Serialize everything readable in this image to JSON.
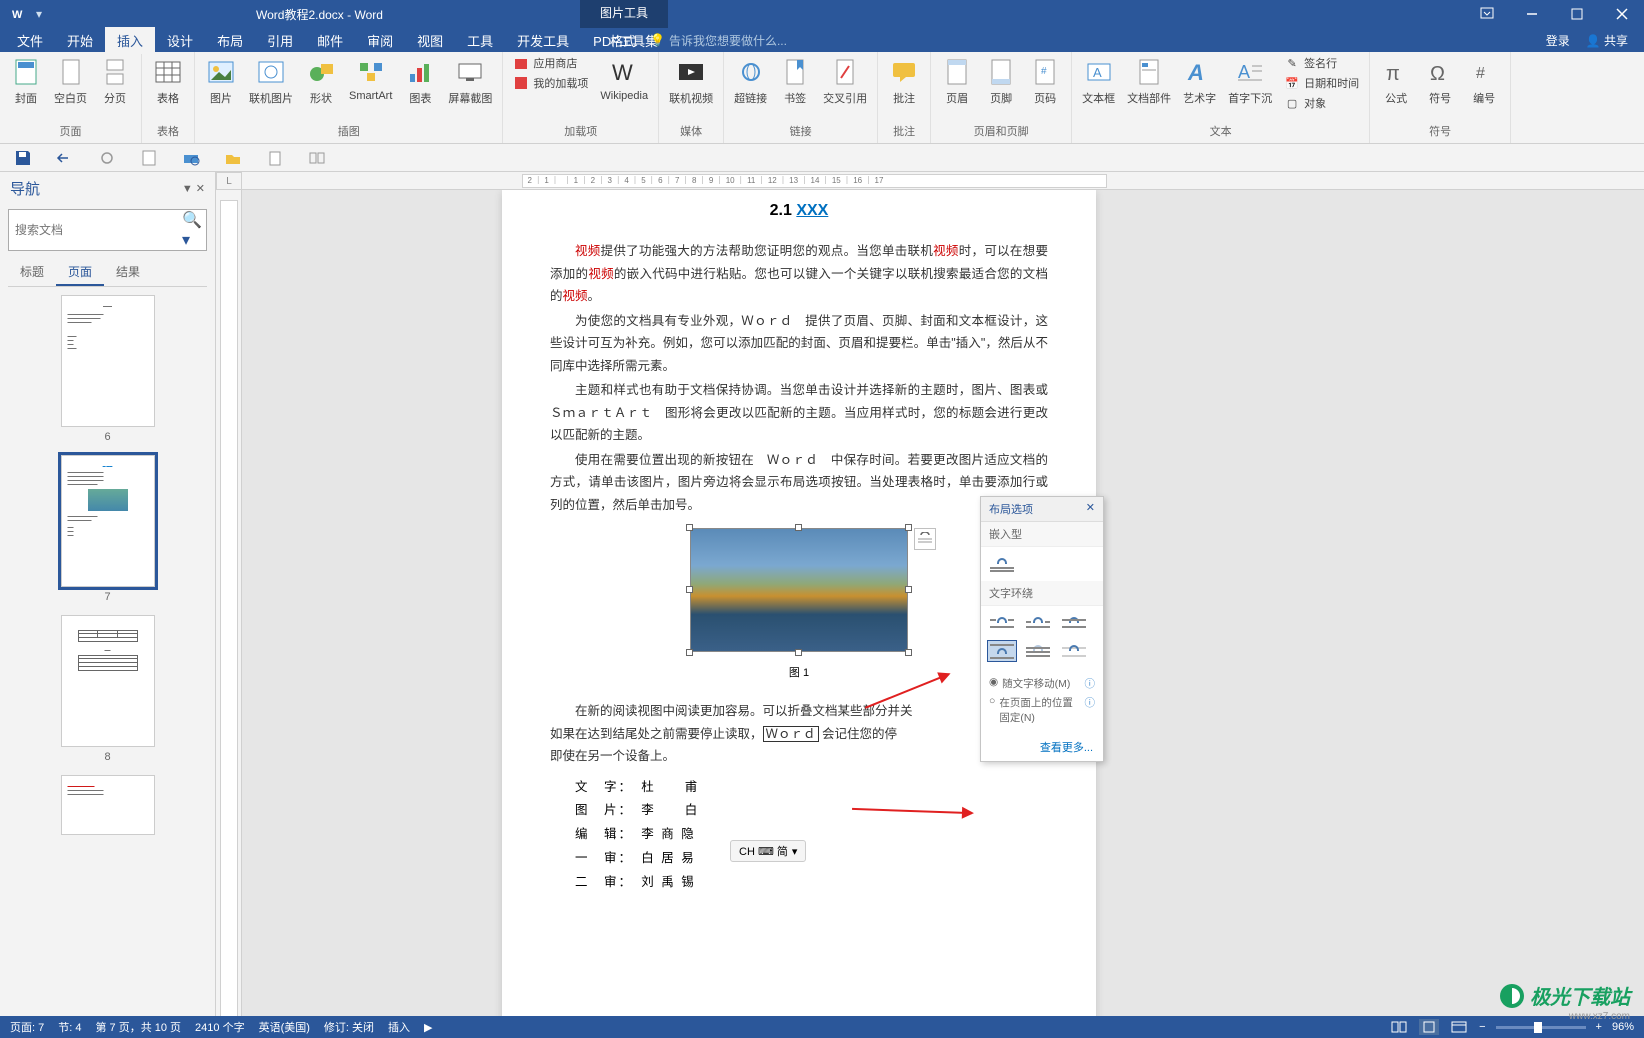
{
  "titlebar": {
    "filename": "Word教程2.docx - Word",
    "picture_tools": "图片工具"
  },
  "tabs": {
    "file": "文件",
    "home": "开始",
    "insert": "插入",
    "design": "设计",
    "layout": "布局",
    "references": "引用",
    "mailings": "邮件",
    "review": "审阅",
    "view": "视图",
    "tools": "工具",
    "dev": "开发工具",
    "pdf": "PDF工具集",
    "format": "格式",
    "tellme_placeholder": "告诉我您想要做什么...",
    "login": "登录",
    "share": "共享"
  },
  "ribbon": {
    "groups": {
      "pages": "页面",
      "tables": "表格",
      "illustrations": "插图",
      "addins": "加载项",
      "media": "媒体",
      "links": "链接",
      "comments": "批注",
      "headerfooter": "页眉和页脚",
      "text": "文本",
      "symbols": "符号"
    },
    "btns": {
      "cover": "封面",
      "blank": "空白页",
      "pagebreak": "分页",
      "table": "表格",
      "picture": "图片",
      "online_pic": "联机图片",
      "shapes": "形状",
      "smartart": "SmartArt",
      "chart": "图表",
      "screenshot": "屏幕截图",
      "store": "应用商店",
      "myaddins": "我的加载项",
      "wikipedia": "Wikipedia",
      "online_video": "联机视频",
      "hyperlink": "超链接",
      "bookmark": "书签",
      "crossref": "交叉引用",
      "comment": "批注",
      "header": "页眉",
      "footer": "页脚",
      "pagenum": "页码",
      "textbox": "文本框",
      "docparts": "文档部件",
      "wordart": "艺术字",
      "dropcap": "首字下沉",
      "sigline": "签名行",
      "datetime": "日期和时间",
      "object": "对象",
      "equation": "公式",
      "symbol": "符号",
      "number": "编号"
    }
  },
  "nav": {
    "title": "导航",
    "search_placeholder": "搜索文档",
    "tabs": {
      "headings": "标题",
      "pages": "页面",
      "results": "结果"
    },
    "thumbs": [
      "6",
      "7",
      "8"
    ]
  },
  "document": {
    "section_num": "2.1 ",
    "section_title": "XXX",
    "p1_a": "视频",
    "p1_b": "提供了功能强大的方法帮助您证明您的观点。当您单击联机",
    "p1_c": "视频",
    "p1_d": "时，可以在想要添加的",
    "p1_e": "视频",
    "p1_f": "的嵌入代码中进行粘贴。您也可以键入一个关键字以联机搜索最适合您的文档的",
    "p1_g": "视频",
    "p1_h": "。",
    "p2": "为使您的文档具有专业外观，Ｗｏｒｄ　提供了页眉、页脚、封面和文本框设计，这些设计可互为补充。例如，您可以添加匹配的封面、页眉和提要栏。单击\"插入\"，然后从不同库中选择所需元素。",
    "p3": "主题和样式也有助于文档保持协调。当您单击设计并选择新的主题时，图片、图表或　ＳｍａｒｔＡｒｔ　图形将会更改以匹配新的主题。当应用样式时，您的标题会进行更改以匹配新的主题。",
    "p4": "使用在需要位置出现的新按钮在　Ｗｏｒｄ　中保存时间。若要更改图片适应文档的方式，请单击该图片，图片旁边将会显示布局选项按钮。当处理表格时，单击要添加行或列的位置，然后单击加号。",
    "fig_caption": "图 1",
    "p5_a": "在新的阅读视图中阅读更加容易。可以折叠文档某些部分并关",
    "p5_b": "如果在达到结尾处之前需要停止读取，",
    "p5_c": "Ｗｏｒｄ",
    "p5_d": "会记住您的停",
    "p5_e": "即使在另一个设备上。",
    "credits": {
      "l1": "文　字：　杜　　甫",
      "l2": "图　片：　李　　白",
      "l3": "编　辑：　李 商 隐",
      "l4": "一　审：　白 居 易",
      "l5": "二　审：　刘 禹 锡"
    }
  },
  "layout_popup": {
    "title": "布局选项",
    "inline": "嵌入型",
    "wrap": "文字环绕",
    "radio1": "随文字移动(M)",
    "radio2": "在页面上的位置固定(N)",
    "more": "查看更多..."
  },
  "statusbar": {
    "page": "页面: 7",
    "section": "节: 4",
    "page_of": "第 7 页，共 10 页",
    "words": "2410 个字",
    "lang": "英语(美国)",
    "track": "修订: 关闭",
    "insert": "插入",
    "zoom": "96%"
  },
  "ime": {
    "label": "CH ⌨ 简"
  },
  "watermark": {
    "brand": "极光下载站",
    "url": "www.xz7.com"
  }
}
